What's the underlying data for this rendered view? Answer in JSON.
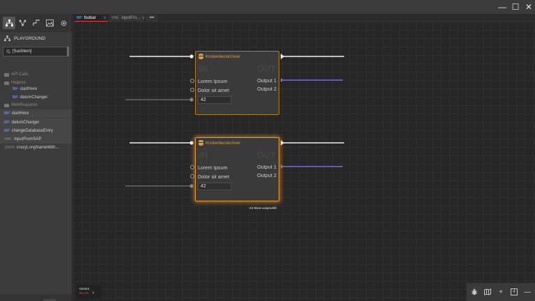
{
  "window": {
    "minimize_glyph": "—",
    "maximize_glyph": "☐",
    "close_glyph": "✕"
  },
  "sidebar": {
    "toolbar_icons": [
      "hierarchy-icon",
      "graph-icon",
      "flow-icon",
      "image-icon",
      "gear-icon"
    ],
    "playground_label": "PLAYGROUND",
    "search_value": "[Suchtern]",
    "tree": [
      {
        "type": "folder",
        "label": "API Calls",
        "indent": 0
      },
      {
        "type": "folder",
        "label": "Helpers",
        "indent": 0
      },
      {
        "prefix": "BP",
        "label": "startHere",
        "indent": 1
      },
      {
        "prefix": "BP",
        "label": "datumChanger",
        "indent": 1
      },
      {
        "type": "folder",
        "label": "WebRequests",
        "indent": 0
      },
      {
        "prefix": "BP",
        "label": "startHere",
        "indent": 0
      },
      {
        "prefix": "BP",
        "label": "datumChanger",
        "indent": 0
      },
      {
        "prefix": "BP",
        "label": "changeDatabaseEntry",
        "indent": 0
      },
      {
        "prefix": "XML",
        "label": "inputFromSAP",
        "indent": 0
      },
      {
        "prefix": "JSON",
        "label": "crazyLongNameWith..."
      }
    ]
  },
  "tabs": [
    {
      "prefix": "BP",
      "label": "foobar",
      "active": true,
      "close": "x"
    },
    {
      "prefix": "XML",
      "label": "inputFro...",
      "active": false,
      "close": "x"
    }
  ],
  "tabs_more": "•••",
  "node_top": {
    "title": "Knotenbezeichner",
    "ghost_in": "IN",
    "ghost_out": "OUT",
    "input_1": "Lorem Ipsum",
    "input_2": "Dolor sit amet",
    "value": "42",
    "output_1": "Output 1",
    "output_2": "Output 2"
  },
  "node_bottom": {
    "title": "Knotenbezeichner",
    "ghost_in": "IN",
    "ghost_out": "OUT",
    "input_1": "Lorem Ipsum",
    "input_2": "Dolor sit amet",
    "value": "42",
    "output_1": "Output 1",
    "output_2": "Output 2"
  },
  "status_text": "mit Maus ausgewählt",
  "news": {
    "line1": "NEWS",
    "line2": "BLOG"
  },
  "bottom_right": {
    "counter": "4"
  },
  "colors": {
    "accent_orange": "#e49a3a",
    "wire_purple": "#7a6ae0",
    "wire_white": "#f0f0f0",
    "tab_active_underline": "#d04040"
  }
}
